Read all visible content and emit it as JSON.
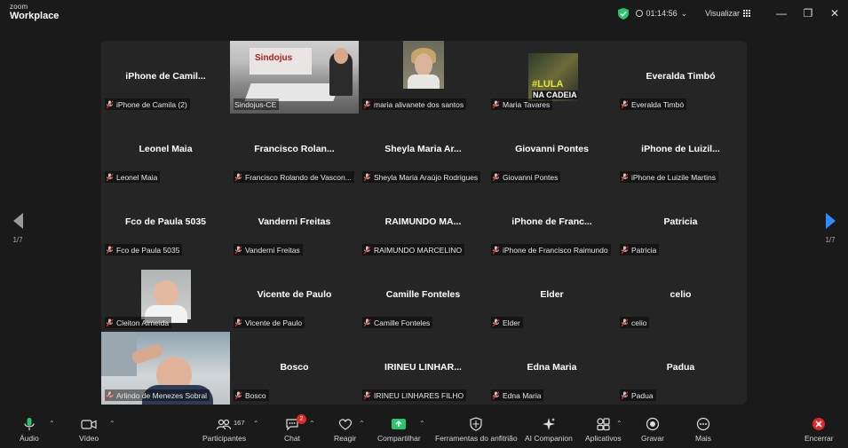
{
  "app": {
    "logo_small": "zoom",
    "logo_big": "Workplace"
  },
  "titlebar": {
    "timer": "01:14:56",
    "view_label": "Visualizar",
    "shield_color": "#2bc36b"
  },
  "gallery": {
    "page_left": "1/7",
    "page_right": "1/7",
    "tiles": [
      {
        "center": "iPhone de Camil...",
        "label": "iPhone de Camila (2)"
      },
      {
        "center": "",
        "label": "Sindojus-CE"
      },
      {
        "center": "",
        "label": "maria alivanete dos santos"
      },
      {
        "center": "",
        "label": "Maria Tavares"
      },
      {
        "center": "Everalda Timbó",
        "label": "Everalda Timbó"
      },
      {
        "center": "Leonel Maia",
        "label": "Leonel Maia"
      },
      {
        "center": "Francisco Rolan...",
        "label": "Francisco Rolando de Vascon..."
      },
      {
        "center": "Sheyla Maria Ar...",
        "label": "Sheyla Maria Araújo Rodrigues"
      },
      {
        "center": "Giovanni Pontes",
        "label": "Giovanni Pontes"
      },
      {
        "center": "iPhone de Luizil...",
        "label": "iPhone de Luizile Martins"
      },
      {
        "center": "Fco de Paula 5035",
        "label": "Fco de Paula 5035"
      },
      {
        "center": "Vanderni Freitas",
        "label": "Vanderni Freitas"
      },
      {
        "center": "RAIMUNDO MA...",
        "label": "RAIMUNDO MARCELINO"
      },
      {
        "center": "iPhone de Franc...",
        "label": "iPhone de Francisco Raimundo"
      },
      {
        "center": "Patricia",
        "label": "Patricia"
      },
      {
        "center": "",
        "label": "Cleiton Almeida"
      },
      {
        "center": "Vicente de Paulo",
        "label": "Vicente de Paulo"
      },
      {
        "center": "Camille Fonteles",
        "label": "Camille Fonteles"
      },
      {
        "center": "Elder",
        "label": "Elder"
      },
      {
        "center": "celio",
        "label": "celio"
      },
      {
        "center": "",
        "label": "Arlindo de Menezes Sobral"
      },
      {
        "center": "Bosco",
        "label": "Bosco"
      },
      {
        "center": "IRINEU LINHAR...",
        "label": "IRINEU LINHARES FILHO"
      },
      {
        "center": "Edna Maria",
        "label": "Edna Maria"
      },
      {
        "center": "Padua",
        "label": "Padua"
      }
    ],
    "video_texts": {
      "room_banner": "Sindojus",
      "poster_line1": "#LULA",
      "poster_line2": "NA CADEIA"
    }
  },
  "toolbar": {
    "audio": "Áudio",
    "video": "Vídeo",
    "participants": "Participantes",
    "participants_count": "167",
    "chat": "Chat",
    "chat_badge": "2",
    "react": "Reagir",
    "share": "Compartilhar",
    "host_tools": "Ferramentas do anfitrião",
    "ai": "AI Companion",
    "apps": "Aplicativos",
    "record": "Gravar",
    "more": "Mais",
    "end": "Encerrar",
    "share_color": "#2bc36b",
    "end_color": "#e02828"
  }
}
